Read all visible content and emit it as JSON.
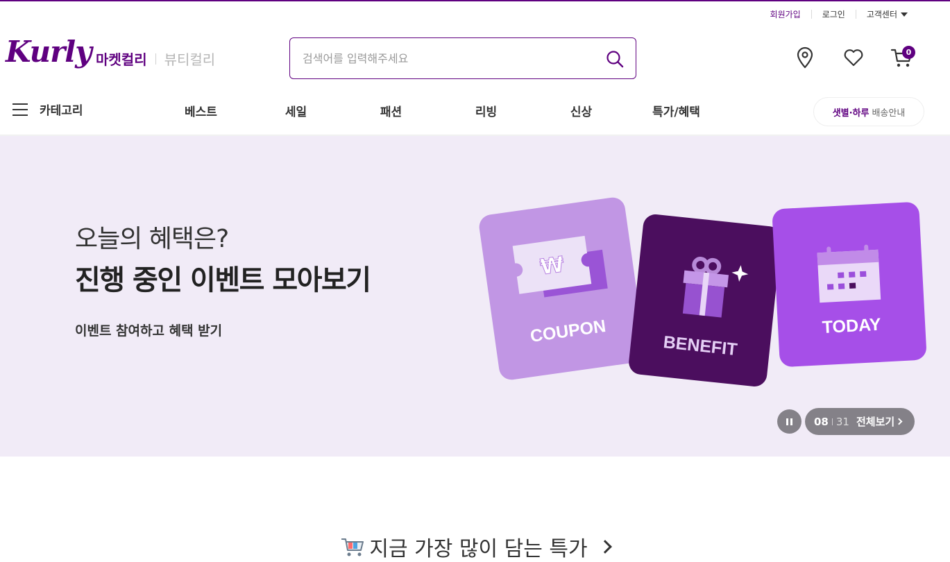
{
  "util": {
    "signup": "회원가입",
    "login": "로그인",
    "customer_center": "고객센터"
  },
  "header": {
    "logo": "Kurly",
    "brand_active": "마켓컬리",
    "brand_inactive": "뷰티컬리",
    "search_placeholder": "검색어를 입력해주세요",
    "cart_count": "0",
    "accent_color": "#5f0080"
  },
  "gnb": {
    "category": "카테고리",
    "menu": [
      "베스트",
      "세일",
      "패션",
      "리빙",
      "신상",
      "특가/혜택"
    ],
    "delivery_highlight": "샛별·하루",
    "delivery_text": "배송안내"
  },
  "banner": {
    "subtitle": "오늘의 혜택은?",
    "title": "진행 중인 이벤트 모아보기",
    "description": "이벤트 참여하고 혜택 받기",
    "cards": [
      "COUPON",
      "BENEFIT",
      "TODAY"
    ],
    "current": "08",
    "total": "31",
    "view_all": "전체보기",
    "background": "#f1ebf7"
  },
  "section": {
    "title": "지금 가장 많이 담는 특가"
  }
}
